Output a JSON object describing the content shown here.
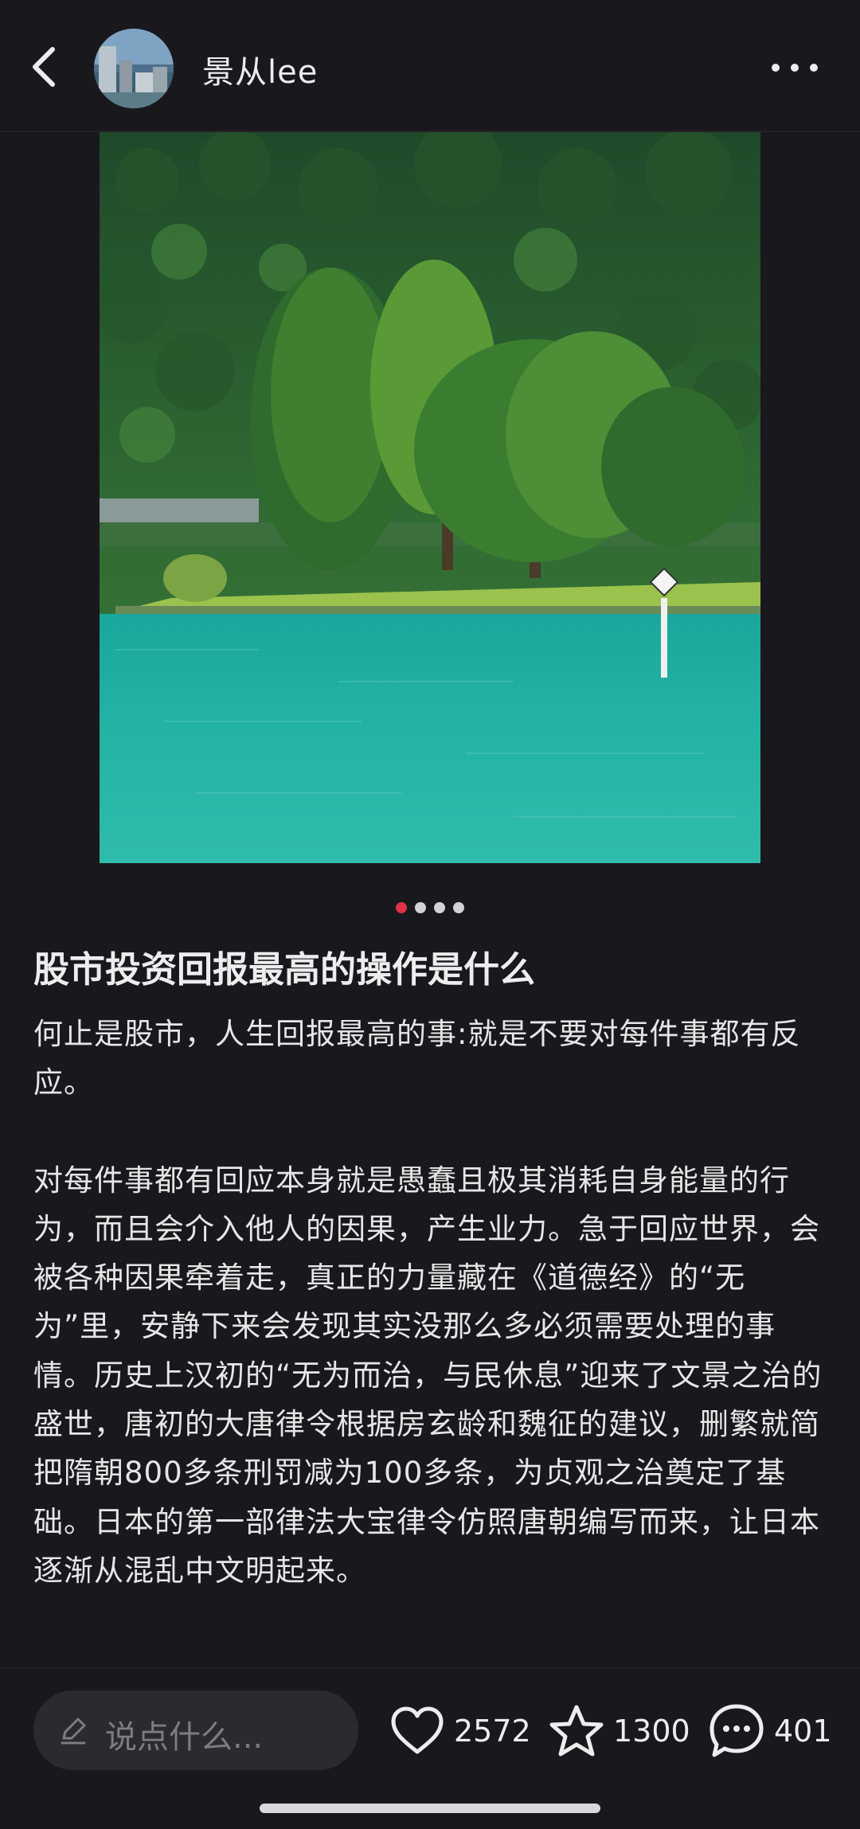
{
  "header": {
    "author_name": "景从lee",
    "back_icon": "chevron-left-icon",
    "more_icon": "ellipsis-horizontal-icon"
  },
  "carousel": {
    "total": 4,
    "active_index": 0,
    "active_color": "#e0324a"
  },
  "post": {
    "title": "股市投资回报最高的操作是什么",
    "paragraphs": [
      "何止是股市，人生回报最高的事:就是不要对每件事都有反应。",
      "对每件事都有回应本身就是愚蠢且极其消耗自身能量的行为，而且会介入他人的因果，产生业力。急于回应世界，会被各种因果牵着走，真正的力量藏在《道德经》的“无为”里，安静下来会发现其实没那么多必须需要处理的事情。历史上汉初的“无为而治，与民休息”迎来了文景之治的盛世，唐初的大唐律令根据房玄龄和魏征的建议，删繁就简把隋朝800多条刑罚减为100多条，为贞观之治奠定了基础。日本的第一部律法大宝律令仿照唐朝编写而来，让日本逐渐从混乱中文明起来。"
    ]
  },
  "bottom_bar": {
    "comment_placeholder": "说点什么...",
    "likes": "2572",
    "favorites": "1300",
    "comments": "401"
  }
}
